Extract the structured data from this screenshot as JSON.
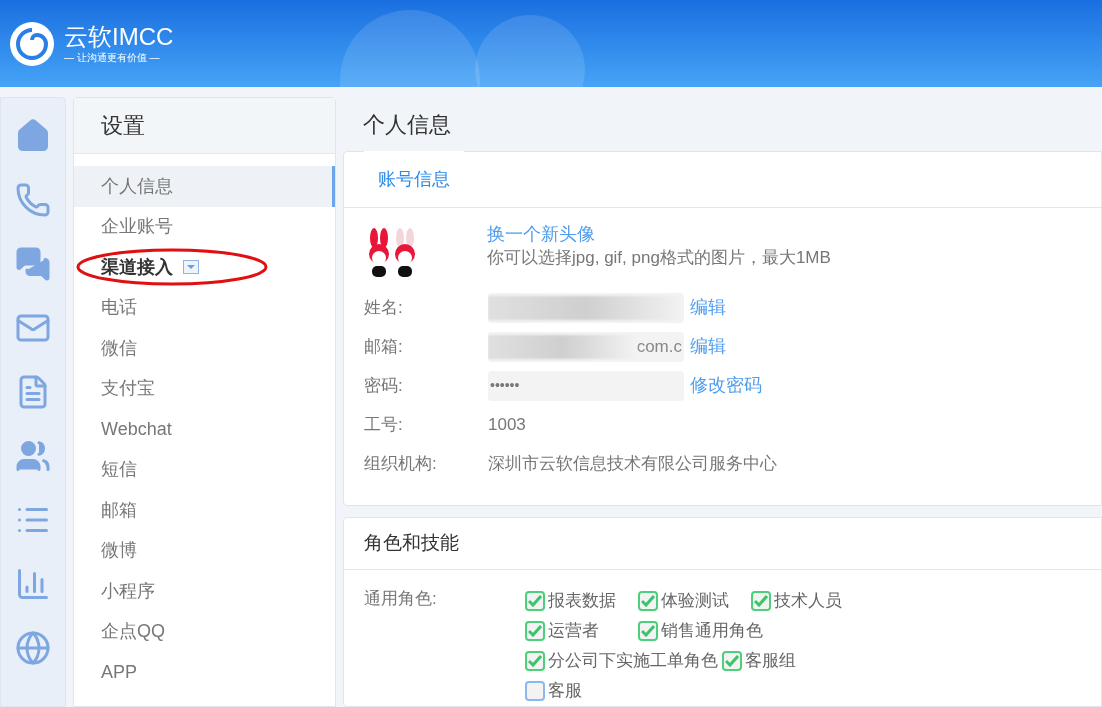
{
  "header": {
    "brand": "云软IMCC",
    "tagline": "— 让沟通更有价值 —"
  },
  "rail": {
    "items": [
      {
        "kind": "home"
      },
      {
        "kind": "phone"
      },
      {
        "kind": "chat"
      },
      {
        "kind": "mail"
      },
      {
        "kind": "report"
      },
      {
        "kind": "users"
      },
      {
        "kind": "list"
      },
      {
        "kind": "chart"
      },
      {
        "kind": "globe"
      }
    ]
  },
  "settings": {
    "title": "设置",
    "items": [
      {
        "label": "个人信息",
        "kind": "item",
        "selected": true
      },
      {
        "label": "企业账号",
        "kind": "item",
        "selected": false
      },
      {
        "label": "渠道接入",
        "kind": "group",
        "selected": false,
        "highlighted": true
      },
      {
        "label": "电话",
        "kind": "item",
        "selected": false
      },
      {
        "label": "微信",
        "kind": "item",
        "selected": false
      },
      {
        "label": "支付宝",
        "kind": "item",
        "selected": false
      },
      {
        "label": "Webchat",
        "kind": "item",
        "selected": false
      },
      {
        "label": "短信",
        "kind": "item",
        "selected": false
      },
      {
        "label": "邮箱",
        "kind": "item",
        "selected": false
      },
      {
        "label": "微博",
        "kind": "item",
        "selected": false
      },
      {
        "label": "小程序",
        "kind": "item",
        "selected": false
      },
      {
        "label": "企点QQ",
        "kind": "item",
        "selected": false
      },
      {
        "label": "APP",
        "kind": "item",
        "selected": false
      }
    ]
  },
  "page": {
    "title": "个人信息"
  },
  "account": {
    "tabs": [
      {
        "label": "账号信息",
        "selected": true
      }
    ],
    "avatar": {
      "kind": "picture",
      "link": "换一个新头像",
      "hint": "你可以选择jpg, gif, png格式的图片，最大1MB"
    },
    "fields": [
      {
        "label": "姓名:",
        "kind": "blurred",
        "action": "编辑"
      },
      {
        "label": "邮箱:",
        "kind": "blurred",
        "value": "com.c",
        "action": "编辑"
      },
      {
        "label": "密码:",
        "kind": "field",
        "value": "••••••",
        "action": "修改密码"
      },
      {
        "label": "工号:",
        "kind": "text",
        "value": "1003"
      },
      {
        "label": "组织机构:",
        "kind": "text",
        "value": "深圳市云软信息技术有限公司服务中心"
      }
    ]
  },
  "roles": {
    "title": "角色和技能",
    "label": "通用角色:",
    "items": [
      {
        "label": "报表数据",
        "checked": true
      },
      {
        "label": "体验测试",
        "checked": true
      },
      {
        "label": "技术人员",
        "checked": true
      },
      {
        "label": "运营者",
        "checked": true
      },
      {
        "label": "销售通用角色",
        "checked": true
      },
      {
        "label": "分公司下实施工单角色",
        "checked": true
      },
      {
        "label": "客服组",
        "checked": true
      },
      {
        "label": "客服",
        "checked": false
      }
    ]
  }
}
